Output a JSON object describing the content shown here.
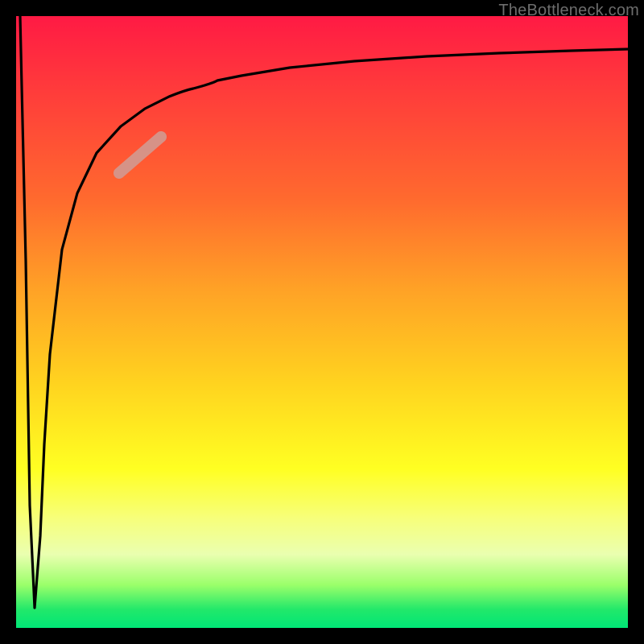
{
  "watermark": "TheBottleneck.com",
  "colors": {
    "frame": "#000000",
    "curve": "#000000",
    "highlight": "#d2988e",
    "gradient_stops": [
      "#ff1a44",
      "#ff3b3b",
      "#ff6a2e",
      "#ffa326",
      "#ffd31f",
      "#ffff22",
      "#f7ff7a",
      "#eaffb0",
      "#9aff6a",
      "#22e86a",
      "#00e676"
    ]
  },
  "chart_data": {
    "type": "line",
    "title": "",
    "xlabel": "",
    "ylabel": "",
    "xlim": [
      0,
      100
    ],
    "ylim": [
      0,
      100
    ],
    "note": "Axes unlabeled in source image; values are normalized 0–100 in each direction. y is plotted with 0 at bottom (green) and 100 at top (red). Curve estimated from pixel positions.",
    "series": [
      {
        "name": "bottleneck-curve",
        "x": [
          0.7,
          1.5,
          2.2,
          3.0,
          3.9,
          4.6,
          5.5,
          7.5,
          10.0,
          13.2,
          17.1,
          21.1,
          25.0,
          28.9,
          32.9,
          36.8,
          44.7,
          55.3,
          67.1,
          78.9,
          90.8,
          100.0
        ],
        "y": [
          100.0,
          60.0,
          20.0,
          3.3,
          15.0,
          30.0,
          44.7,
          61.8,
          71.1,
          77.6,
          82.0,
          84.9,
          86.8,
          88.2,
          89.5,
          90.3,
          91.6,
          92.6,
          93.4,
          93.9,
          94.3,
          94.6
        ]
      }
    ],
    "highlight_segment": {
      "description": "Thick faded-red marker segment on the rising branch",
      "x_range": [
        17.1,
        23.7
      ],
      "y_range": [
        74.3,
        80.3
      ]
    }
  }
}
